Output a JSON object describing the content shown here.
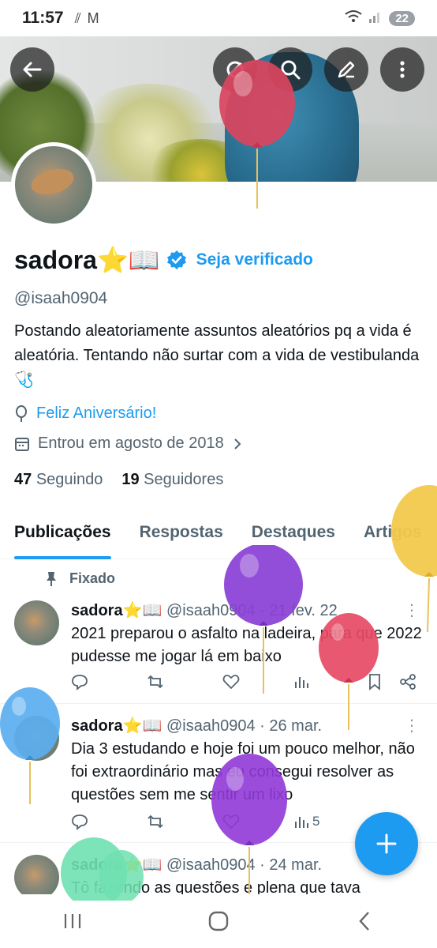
{
  "status_bar": {
    "time": "11:57",
    "battery": "22",
    "left_icons": [
      "signal-dots-icon",
      "gmail-icon"
    ]
  },
  "header": {
    "buttons": [
      "back-icon",
      "grok-icon",
      "search-icon",
      "edit-icon",
      "more-vertical-icon"
    ]
  },
  "profile": {
    "display_name": "sadora⭐📖",
    "verify_cta": "Seja verificado",
    "handle": "@isaah0904",
    "bio": "Postando aleatoriamente assuntos aleatórios pq a vida é aleatória. Tentando não surtar com a vida de vestibulanda🩺",
    "birthday": "Feliz Aniversário!",
    "joined": "Entrou em agosto de 2018",
    "following_count": "47",
    "following_label": "Seguindo",
    "followers_count": "19",
    "followers_label": "Seguidores"
  },
  "tabs": [
    {
      "label": "Publicações",
      "active": true
    },
    {
      "label": "Respostas",
      "active": false
    },
    {
      "label": "Destaques",
      "active": false
    },
    {
      "label": "Artigos",
      "active": false
    }
  ],
  "pinned_label": "Fixado",
  "tweets": [
    {
      "name": "sadora⭐📖",
      "handle": "@isaah0904",
      "sep": "·",
      "date": "21 fev. 22",
      "text": "2021 preparou o asfalto na ladeira, para que 2022 pudesse me jogar lá em baixo",
      "views": ""
    },
    {
      "name": "sadora⭐📖",
      "handle": "@isaah0904",
      "sep": "·",
      "date": "26 mar.",
      "text": "Dia 3 estudando e hoje foi um pouco melhor, não foi extraordinário mas eu consegui resolver as questões sem me sentir um lixo",
      "views": "5"
    },
    {
      "name": "sadora⭐📖",
      "handle": "@isaah0904",
      "sep": "·",
      "date": "24 mar.",
      "text": "Tô fazendo as questões e plena que tava",
      "views": ""
    }
  ],
  "colors": {
    "accent": "#1d9bf0",
    "text_primary": "#0f1419",
    "text_secondary": "#536471"
  }
}
